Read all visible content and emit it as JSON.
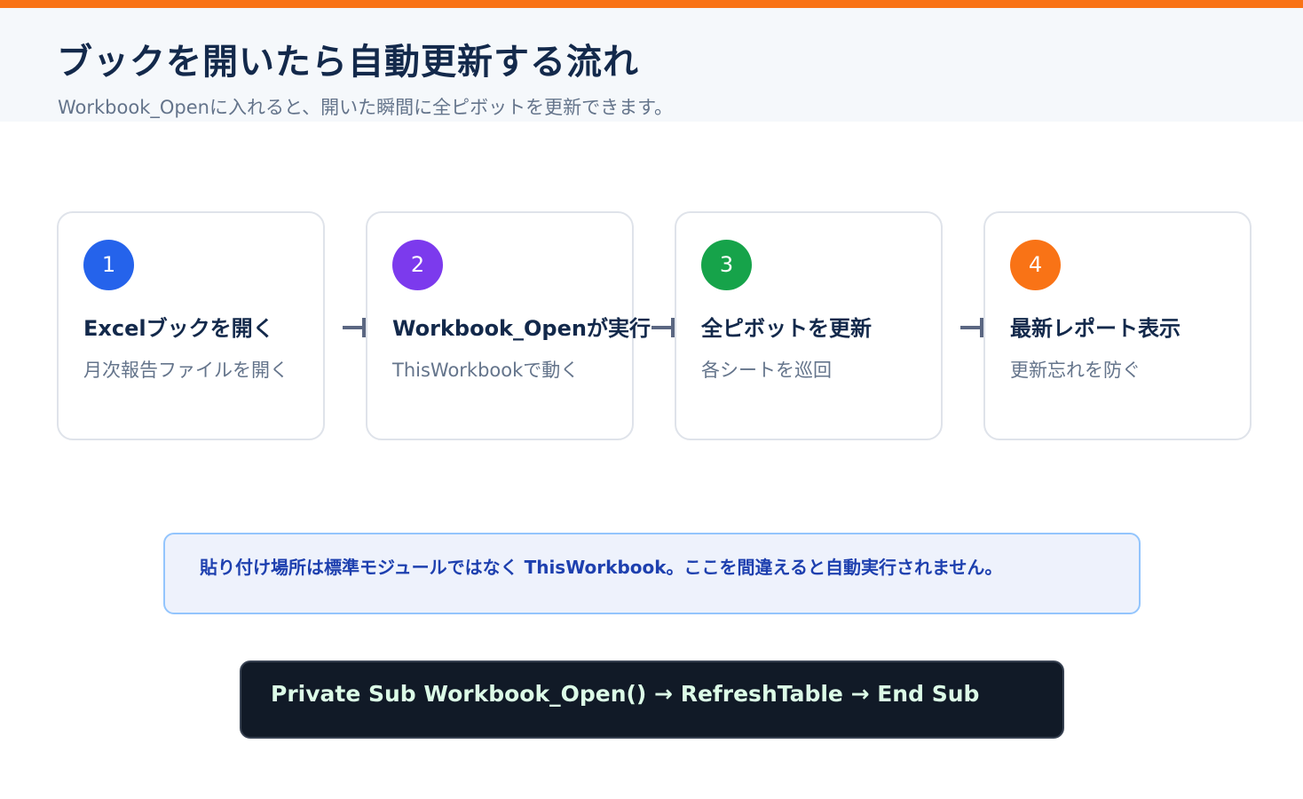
{
  "header": {
    "title": "ブックを開いたら自動更新する流れ",
    "subtitle": "Workbook_Openに入れると、開いた瞬間に全ピボットを更新できます。"
  },
  "steps": [
    {
      "number": "1",
      "title": "Excelブックを開く",
      "description": "月次報告ファイルを開く",
      "color": "#2563eb"
    },
    {
      "number": "2",
      "title": "Workbook_Openが実行",
      "description": "ThisWorkbookで動く",
      "color": "#7c3aed"
    },
    {
      "number": "3",
      "title": "全ピボットを更新",
      "description": "各シートを巡回",
      "color": "#16a34a"
    },
    {
      "number": "4",
      "title": "最新レポート表示",
      "description": "更新忘れを防ぐ",
      "color": "#f97316"
    }
  ],
  "note": {
    "text": "貼り付け場所は標準モジュールではなく ThisWorkbook。ここを間違えると自動実行されません。"
  },
  "code": {
    "text": "Private Sub Workbook_Open() → RefreshTable → End Sub"
  }
}
